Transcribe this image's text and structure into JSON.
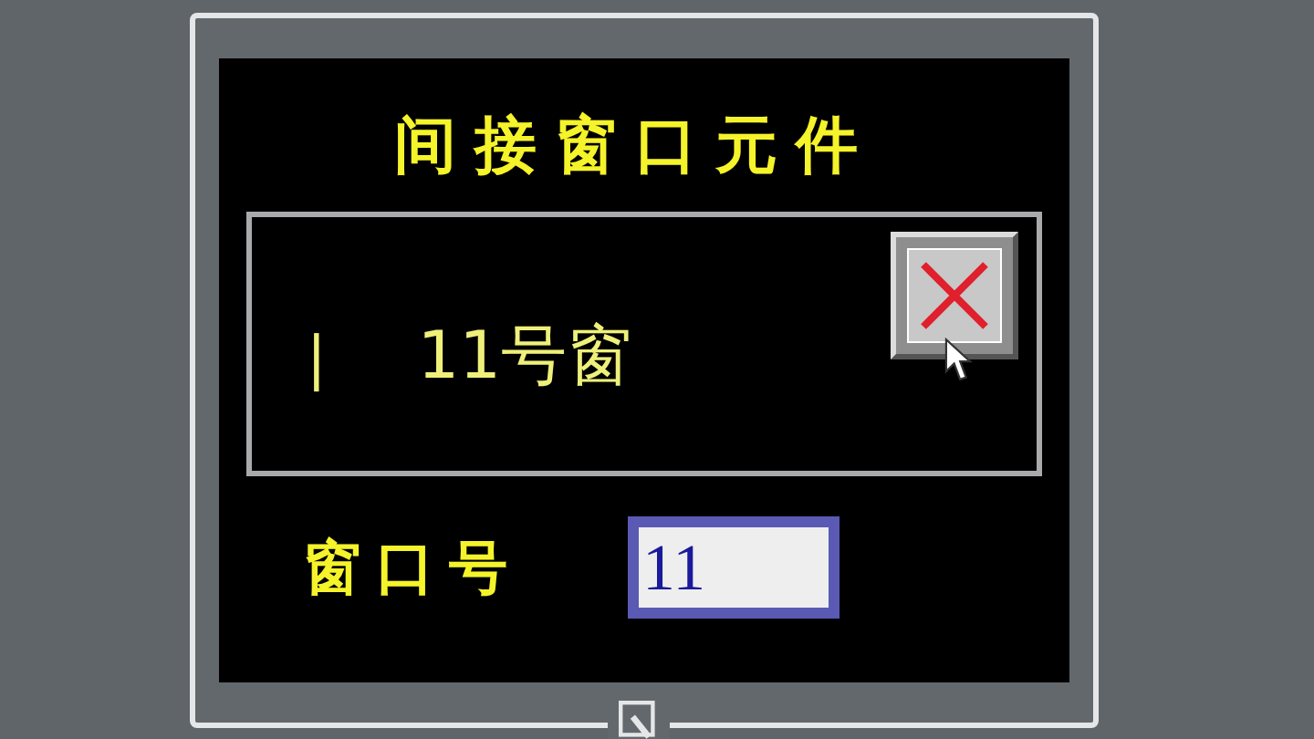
{
  "title": "间接窗口元件",
  "indirect_window": {
    "marker": "|",
    "content": "11号窗"
  },
  "window_number": {
    "label": "窗口号",
    "value": "11",
    "focused": true
  }
}
